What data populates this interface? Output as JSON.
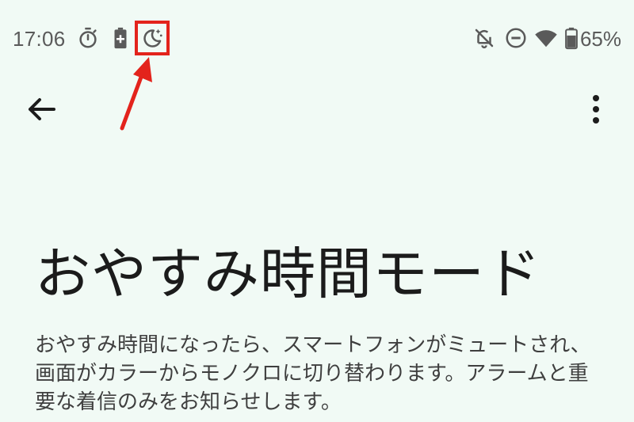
{
  "status_bar": {
    "time": "17:06",
    "battery_percent": "65%",
    "left_icons": [
      "timer-icon",
      "battery-saver-icon",
      "bedtime-moon-icon"
    ],
    "right_icons": [
      "notifications-off-icon",
      "do-not-disturb-icon",
      "wifi-icon",
      "battery-icon"
    ]
  },
  "app_bar": {
    "back_icon": "arrow-back-icon",
    "menu_icon": "more-vert-icon"
  },
  "page": {
    "title": "おやすみ時間モード",
    "description": "おやすみ時間になったら、スマートフォンがミュートされ、画面がカラーからモノクロに切り替わります。アラームと重要な着信のみをお知らせします。"
  },
  "annotation": {
    "highlight_color": "#e3231c"
  }
}
